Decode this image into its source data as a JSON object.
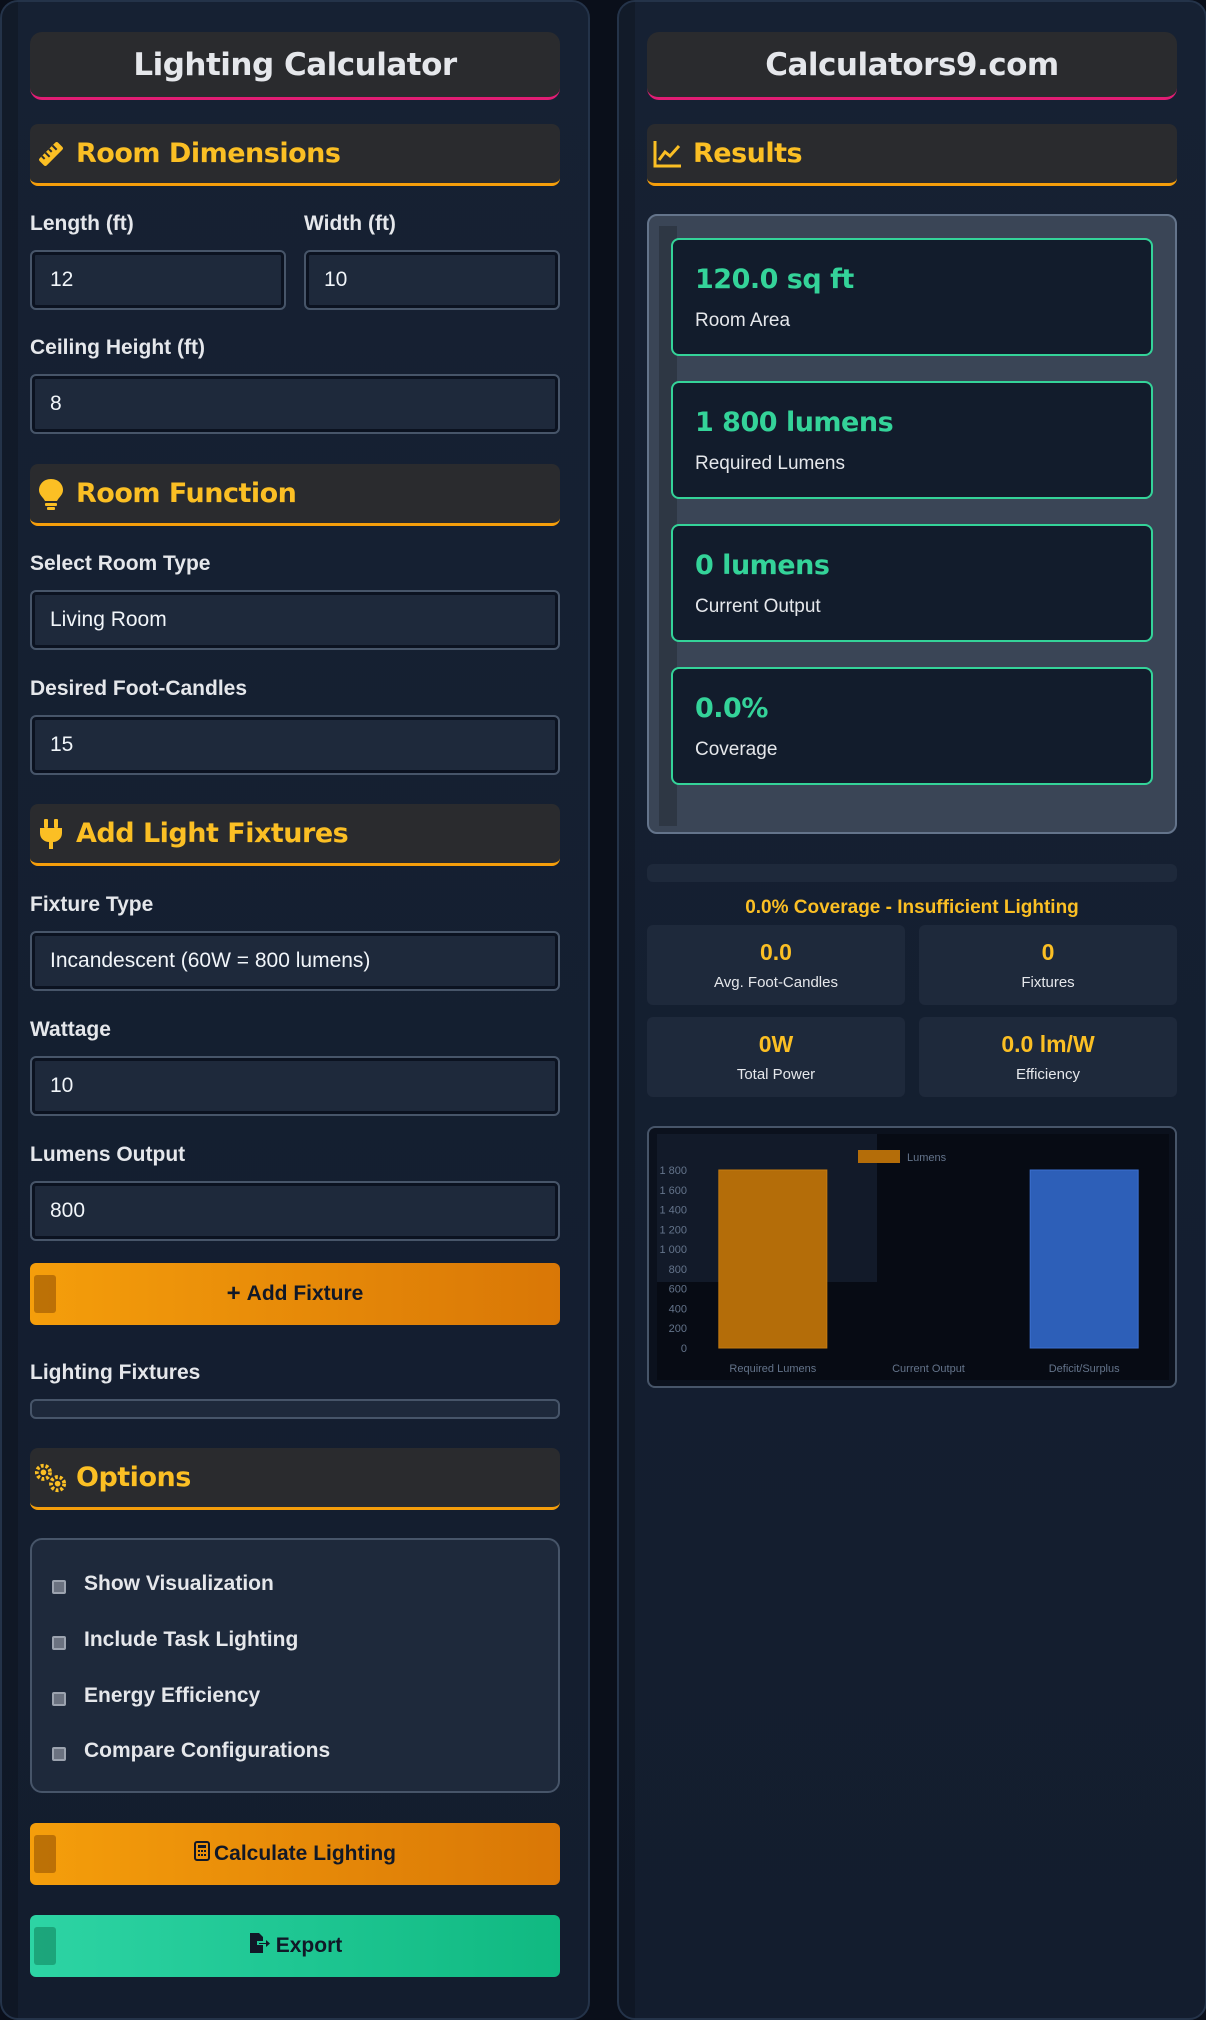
{
  "left": {
    "title": "Lighting Calculator",
    "room_dimensions": {
      "heading": "Room Dimensions",
      "length_label": "Length (ft)",
      "length_value": "12",
      "width_label": "Width (ft)",
      "width_value": "10",
      "ceiling_label": "Ceiling Height (ft)",
      "ceiling_value": "8"
    },
    "room_function": {
      "heading": "Room Function",
      "type_label": "Select Room Type",
      "type_value": "Living Room",
      "fc_label": "Desired Foot-Candles",
      "fc_value": "15"
    },
    "fixtures": {
      "heading": "Add Light Fixtures",
      "fixture_type_label": "Fixture Type",
      "fixture_type_value": "Incandescent (60W = 800 lumens)",
      "wattage_label": "Wattage",
      "wattage_value": "10",
      "lumens_label": "Lumens Output",
      "lumens_value": "800",
      "add_button": "Add Fixture",
      "list_label": "Lighting Fixtures"
    },
    "options": {
      "heading": "Options",
      "items": [
        "Show Visualization",
        "Include Task Lighting",
        "Energy Efficiency",
        "Compare Configurations"
      ]
    },
    "calculate_button": "Calculate Lighting",
    "export_button": "Export"
  },
  "right": {
    "title": "Calculators9.com",
    "results_heading": "Results",
    "cards": [
      {
        "value": "120.0 sq ft",
        "label": "Room Area"
      },
      {
        "value": "1 800 lumens",
        "label": "Required Lumens"
      },
      {
        "value": "0 lumens",
        "label": "Current Output"
      },
      {
        "value": "0.0%",
        "label": "Coverage"
      }
    ],
    "coverage_status": "0.0% Coverage - Insufficient Lighting",
    "stats": [
      {
        "value": "0.0",
        "label": "Avg. Foot-Candles"
      },
      {
        "value": "0",
        "label": "Fixtures"
      },
      {
        "value": "0W",
        "label": "Total Power"
      },
      {
        "value": "0.0 lm/W",
        "label": "Efficiency"
      }
    ]
  },
  "chart_data": {
    "type": "bar",
    "categories": [
      "Required Lumens",
      "Current Output",
      "Deficit/Surplus"
    ],
    "series": [
      {
        "name": "Lumens",
        "values": [
          1800,
          0,
          1800
        ]
      }
    ],
    "bar_colors": [
      "#b46d09",
      "#b46d09",
      "#2d5fb8"
    ],
    "yticks": [
      "1 800",
      "1 600",
      "1 400",
      "1 200",
      "1 000",
      "800",
      "600",
      "400",
      "200",
      "0"
    ],
    "ylim": [
      0,
      1800
    ],
    "legend": "top"
  },
  "colors": {
    "accent_gold": "#fbbf24",
    "accent_green": "#34d399",
    "title_underline": "#e11d74",
    "button_orange": "#f59e0b",
    "button_green": "#10b981"
  }
}
